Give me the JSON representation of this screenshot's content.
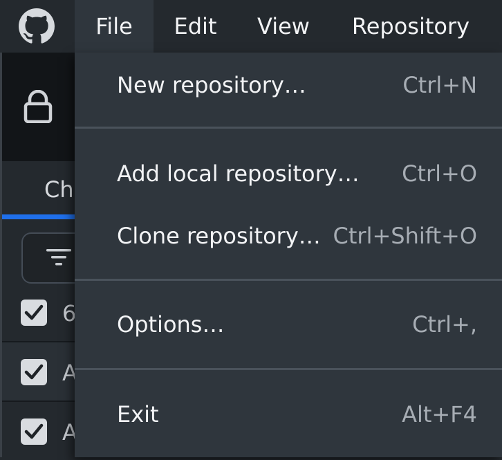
{
  "menubar": {
    "items": [
      {
        "label": "File"
      },
      {
        "label": "Edit"
      },
      {
        "label": "View"
      },
      {
        "label": "Repository"
      }
    ],
    "active": "File"
  },
  "background": {
    "tab_label_partial": "Ch",
    "rows": [
      {
        "text": "6",
        "checked": true
      },
      {
        "text": "A",
        "checked": true
      },
      {
        "text": "A",
        "checked": true
      }
    ]
  },
  "file_menu": {
    "items": [
      {
        "label": "New repository…",
        "shortcut": "Ctrl+N"
      },
      {
        "label": "Add local repository…",
        "shortcut": "Ctrl+O"
      },
      {
        "label": "Clone repository…",
        "shortcut": "Ctrl+Shift+O"
      },
      {
        "label": "Options…",
        "shortcut": "Ctrl+,"
      },
      {
        "label": "Exit",
        "shortcut": "Alt+F4"
      }
    ]
  },
  "icons": {
    "app": "github-icon",
    "lock": "lock-icon",
    "filter": "filter-icon",
    "check": "check-icon"
  },
  "colors": {
    "menubar_bg": "#24292e",
    "dropdown_bg": "#2f363d",
    "accent": "#1f6feb",
    "separator": "#4a525b"
  }
}
